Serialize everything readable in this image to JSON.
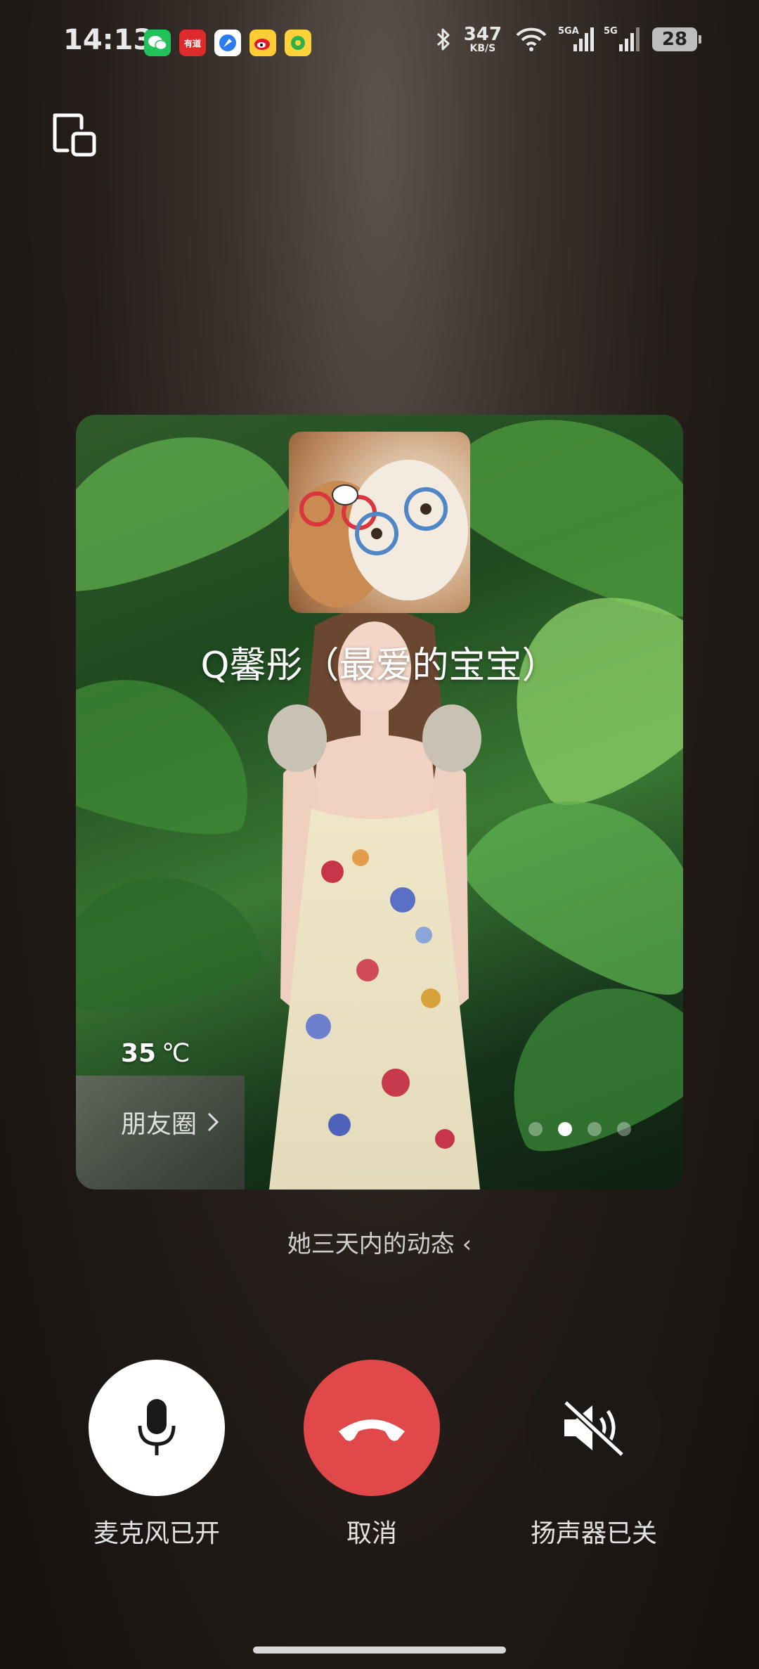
{
  "status_bar": {
    "time": "14:13",
    "net_speed": "347",
    "net_speed_unit": "KB/S",
    "signal1_label": "5GA",
    "signal2_label": "5G",
    "battery": "28",
    "notification_icons": [
      "wechat-icon",
      "youdao-icon",
      "browser-icon",
      "weibo-icon",
      "music-icon"
    ],
    "youdao_text": "有道"
  },
  "card": {
    "contact_name": "Q馨彤（最爱的宝宝）",
    "temperature_value": "35",
    "temperature_unit": "℃",
    "moments_label": "朋友圈",
    "page_count": 4,
    "active_page": 2
  },
  "recent_label": "她三天内的动态 ‹",
  "controls": {
    "mic_label": "麦克风已开",
    "cancel_label": "取消",
    "speaker_label": "扬声器已关"
  },
  "colors": {
    "hangup": "#e0484a",
    "mic_bg": "#ffffff",
    "speaker_bg": "#1b1816"
  }
}
